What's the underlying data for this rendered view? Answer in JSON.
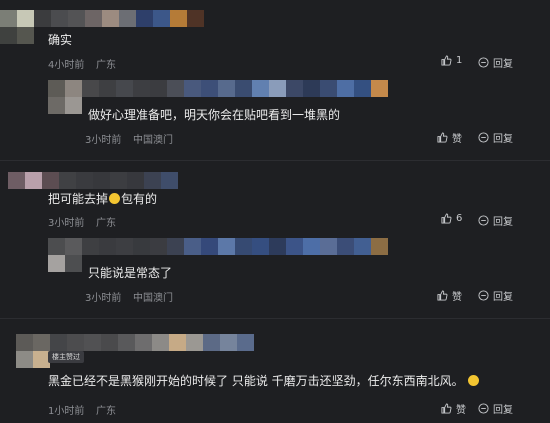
{
  "comments": [
    {
      "text": "确实",
      "time": "4小时前",
      "location": "广东",
      "like_count": "1",
      "reply_label": "回复",
      "replies": [
        {
          "text": "做好心理准备吧，明天你会在贴吧看到一堆黑的",
          "time": "3小时前",
          "location": "中国澳门",
          "like_label": "赞",
          "reply_label": "回复"
        }
      ]
    },
    {
      "text_before": "把可能去掉",
      "emoji": "smile-emoji",
      "text_after": "包有的",
      "time": "3小时前",
      "location": "广东",
      "like_count": "6",
      "reply_label": "回复",
      "replies": [
        {
          "text": "只能说是常态了",
          "time": "3小时前",
          "location": "中国澳门",
          "like_label": "赞",
          "reply_label": "回复"
        }
      ]
    },
    {
      "badge": "楼主赞过",
      "text": "黑金已经不是黑猴刚开始的时候了 只能说 千磨万击还坚劲，任尔东西南北风。",
      "emoji": "grin-emoji",
      "time": "1小时前",
      "location": "广东",
      "like_label": "赞",
      "reply_label": "回复"
    }
  ],
  "icons": {
    "like": "thumb-up-icon",
    "reply": "reply-bubble-icon"
  },
  "colors": {
    "background": "#1e1f22",
    "text": "#ececec",
    "meta": "#8d8f94",
    "emoji": "#f3c531"
  }
}
